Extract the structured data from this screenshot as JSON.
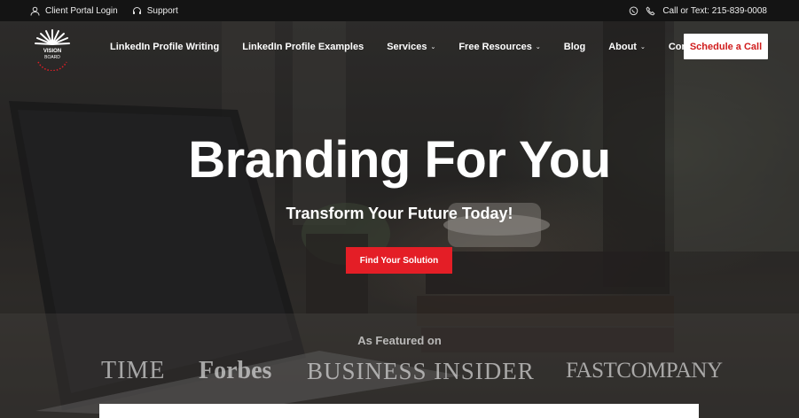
{
  "topbar": {
    "client_portal": "Client Portal Login",
    "support": "Support",
    "call": "Call or Text: 215-839-0008"
  },
  "nav": {
    "logo_text_1": "VISION",
    "logo_text_2": "BOARD",
    "items": [
      {
        "label": "LinkedIn Profile Writing",
        "caret": false
      },
      {
        "label": "LinkedIn Profile Examples",
        "caret": false
      },
      {
        "label": "Services",
        "caret": true
      },
      {
        "label": "Free Resources",
        "caret": true
      },
      {
        "label": "Blog",
        "caret": false
      },
      {
        "label": "About",
        "caret": true
      },
      {
        "label": "Contact",
        "caret": false
      }
    ],
    "cta": "Schedule a Call"
  },
  "hero": {
    "headline": "Branding For You",
    "subline": "Transform Your Future Today!",
    "cta": "Find Your Solution",
    "featured_label": "As Featured on",
    "press": [
      "TIME",
      "Forbes",
      "BUSINESS INSIDER",
      "FASTCOMPANY"
    ]
  },
  "colors": {
    "accent_red": "#e41e26",
    "topbar_bg": "#141414"
  }
}
